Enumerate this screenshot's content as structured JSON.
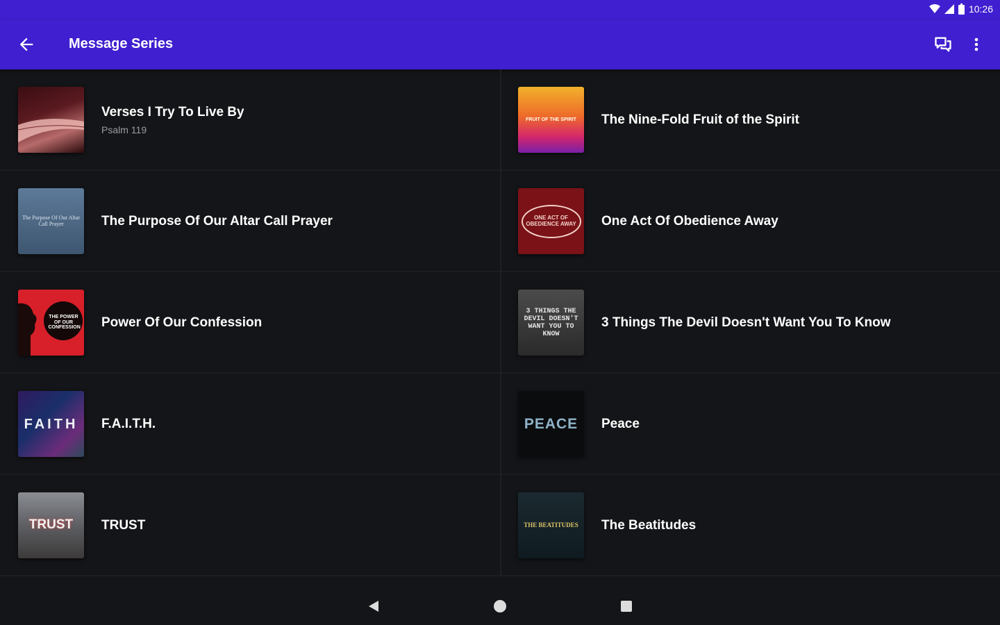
{
  "status_bar": {
    "time": "10:26"
  },
  "app_bar": {
    "title": "Message Series"
  },
  "series": [
    {
      "title": "Verses I Try To Live By",
      "subtitle": "Psalm 119"
    },
    {
      "title": "The Nine-Fold Fruit of the Spirit",
      "subtitle": ""
    },
    {
      "title": "The Purpose Of Our Altar Call Prayer",
      "subtitle": ""
    },
    {
      "title": "One Act Of Obedience Away",
      "subtitle": ""
    },
    {
      "title": "Power Of Our Confession",
      "subtitle": ""
    },
    {
      "title": "3 Things The Devil Doesn't Want You To Know",
      "subtitle": ""
    },
    {
      "title": "F.A.I.T.H.",
      "subtitle": ""
    },
    {
      "title": "Peace",
      "subtitle": ""
    },
    {
      "title": "TRUST",
      "subtitle": ""
    },
    {
      "title": "The Beatitudes",
      "subtitle": ""
    }
  ],
  "thumb_art": {
    "faith": "FAITH",
    "peace": "PEACE",
    "trust": "TRUST",
    "three_things": "3 THINGS THE DEVIL DOESN'T WANT YOU TO KNOW",
    "beatitudes": "THE BEATITUDES",
    "obedience": "ONE ACT OF OBEDIENCE AWAY",
    "altar": "The Purpose Of Our Altar Call Prayer",
    "confession": "THE POWER OF OUR CONFESSION",
    "fruit": "FRUIT OF THE SPIRIT"
  },
  "colors": {
    "accent": "#3f1fcf",
    "background": "#141518"
  }
}
